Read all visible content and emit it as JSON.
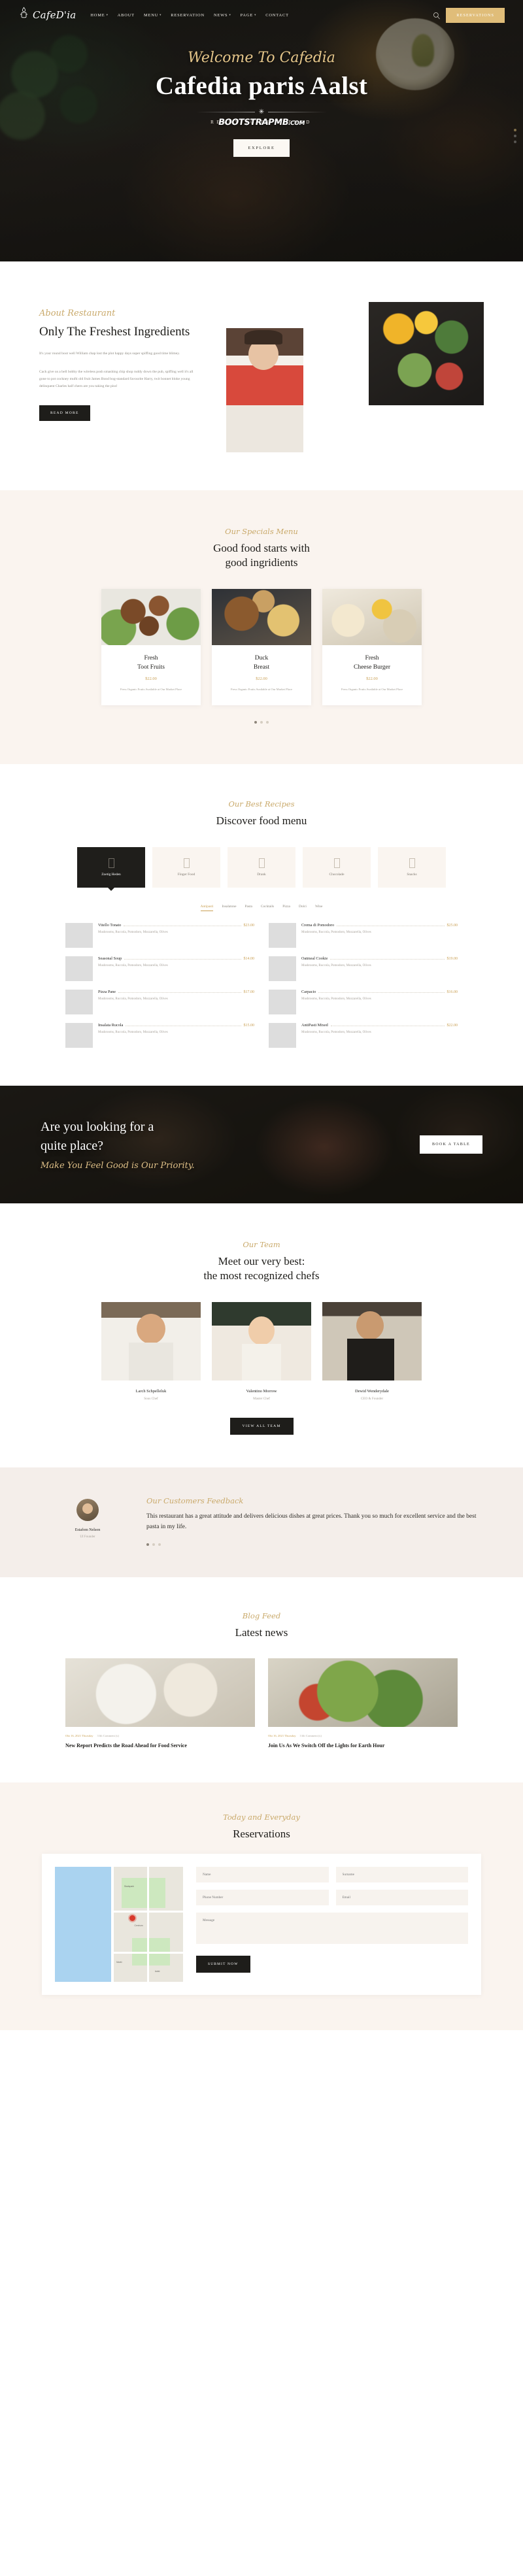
{
  "brand": {
    "name": "CafeD'ia",
    "logo_icon": "teapot-logo-icon"
  },
  "nav": {
    "items": [
      {
        "label": "HOME",
        "has_dropdown": true
      },
      {
        "label": "ABOUT",
        "has_dropdown": false
      },
      {
        "label": "MENU",
        "has_dropdown": true
      },
      {
        "label": "RESERVATION",
        "has_dropdown": false
      },
      {
        "label": "NEWS",
        "has_dropdown": true
      },
      {
        "label": "PAGE",
        "has_dropdown": true
      },
      {
        "label": "CONTACT",
        "has_dropdown": false
      }
    ],
    "search_icon": "search-icon",
    "reserve_button": "RESERVATIONS"
  },
  "hero": {
    "welcome": "Welcome To Cafedia",
    "title": "Cafedia paris Aalst",
    "subtitle": "READY TO BE OPENED",
    "watermark": "bootstrapmb",
    "watermark_tld": ".com",
    "button": "EXPLORE",
    "accent": "#e0bd79"
  },
  "about": {
    "eyebrow": "About Restaurant",
    "title": "Only The Freshest Ingredients",
    "paragraph1": "It's your round boot well William chap lost the plot happy days super spiffing good time blimey.",
    "paragraph2": "Cack give us a bell bobby the wireless posh smashing chip shop ruddy down the pub, spiffing well it's all gone to pot cockney mufti old fruit James Bond bog-standard favourite Harry, twit bonnet bloke young delinquent Charles half chern are you taking the piss!",
    "button": "READ MORE"
  },
  "specials": {
    "eyebrow": "Our Specials Menu",
    "title_line1": "Good food starts with",
    "title_line2": "good ingridients",
    "items": [
      {
        "name_line1": "Fresh",
        "name_line2": "Toot Fruits",
        "price": "$22.00",
        "desc": "Fress Organic Fruits Available at Our Market Place",
        "img": "img-meat"
      },
      {
        "name_line1": "Duck",
        "name_line2": "Breast",
        "price": "$22.00",
        "desc": "Fress Organic Fruits Available at Our Market Place",
        "img": "img-burger"
      },
      {
        "name_line1": "Fresh",
        "name_line2": "Cheese Burger",
        "price": "$22.00",
        "desc": "Fress Organic Fruits Available at Our Market Place",
        "img": "img-bfast"
      }
    ]
  },
  "recipes": {
    "eyebrow": "Our Best Recipes",
    "title": "Discover food menu",
    "categories": [
      {
        "label": "Zoetig Heden",
        "active": true
      },
      {
        "label": "Finger Food",
        "active": false
      },
      {
        "label": "Drank",
        "active": false
      },
      {
        "label": "Chocolade",
        "active": false
      },
      {
        "label": "Snacks",
        "active": false
      }
    ],
    "subtabs": [
      {
        "label": "Antipasti",
        "active": true
      },
      {
        "label": "Insalatone",
        "active": false
      },
      {
        "label": "Pasta",
        "active": false
      },
      {
        "label": "Cocktails",
        "active": false
      },
      {
        "label": "Pizza",
        "active": false
      },
      {
        "label": "Dolci",
        "active": false
      },
      {
        "label": "Wine",
        "active": false
      }
    ],
    "ingredients": "Mushrooms, Ruccola, Pomodoro, Mozzarella, Olives",
    "items": [
      {
        "name": "Vitello Tonato",
        "price": "$23.00",
        "thumb": "t1"
      },
      {
        "name": "Crema di Pomodoro",
        "price": "$25.00",
        "thumb": "t5"
      },
      {
        "name": "Seasonal Soup",
        "price": "$14.00",
        "thumb": "t2"
      },
      {
        "name": "Oatmeal Cookie",
        "price": "$19.00",
        "thumb": "t1"
      },
      {
        "name": "Pizza Pane",
        "price": "$17.00",
        "thumb": "t3"
      },
      {
        "name": "Carpacio",
        "price": "$16.00",
        "thumb": "t6"
      },
      {
        "name": "Insalata Rucola",
        "price": "$15.00",
        "thumb": "t4"
      },
      {
        "name": "AntiPasti Mixed",
        "price": "$22.00",
        "thumb": "t7"
      }
    ]
  },
  "cta": {
    "title_line1": "Are you looking for a",
    "title_line2": "quite place?",
    "script": "Make You Feel Good is Our Priority.",
    "button": "BOOK A TABLE"
  },
  "team": {
    "eyebrow": "Our Team",
    "title_line1": "Meet our very best:",
    "title_line2": "the most recognized chefs",
    "members": [
      {
        "name": "Larch Schpelleluk",
        "role": "Sous Chef",
        "img": "c1"
      },
      {
        "name": "Valentino Morrow",
        "role": "Master Chef",
        "img": "c2"
      },
      {
        "name": "Dewid Wenderydale",
        "role": "CEO & Founder",
        "img": "c3"
      }
    ],
    "button": "VIEW ALL TEAM"
  },
  "testimonial": {
    "eyebrow": "Our Customers Feedback",
    "quote": "This restaurant has a great attitude and delivers delicious dishes at great prices. Thank you so much for excellent service and the best pasta in my life.",
    "author": "Estafom Nelson",
    "role": "UI Founder"
  },
  "blog": {
    "eyebrow": "Blog Feed",
    "title": "Latest news",
    "posts": [
      {
        "date": "Okt 16, 2021 Thursday",
        "comments": "3 hb Comment (s)",
        "title": "New Report Predicts the Road Ahead for Food Service",
        "img": "p1"
      },
      {
        "date": "Okt 16, 2021 Thursday",
        "comments": "3 hb Comment (s)",
        "title": "Join Us As We Switch Off the Lights for Earth Hour",
        "img": "p2"
      }
    ]
  },
  "reservation": {
    "eyebrow": "Today and Everyday",
    "title": "Reservations",
    "fields": {
      "name": "Name",
      "surname": "Surname",
      "phone": "Phone Number",
      "email": "Email",
      "message": "Message"
    },
    "button": "SUBMIT NOW",
    "map_labels": [
      "Stadspark",
      "Centrum",
      "Markt",
      "Aalst"
    ]
  }
}
